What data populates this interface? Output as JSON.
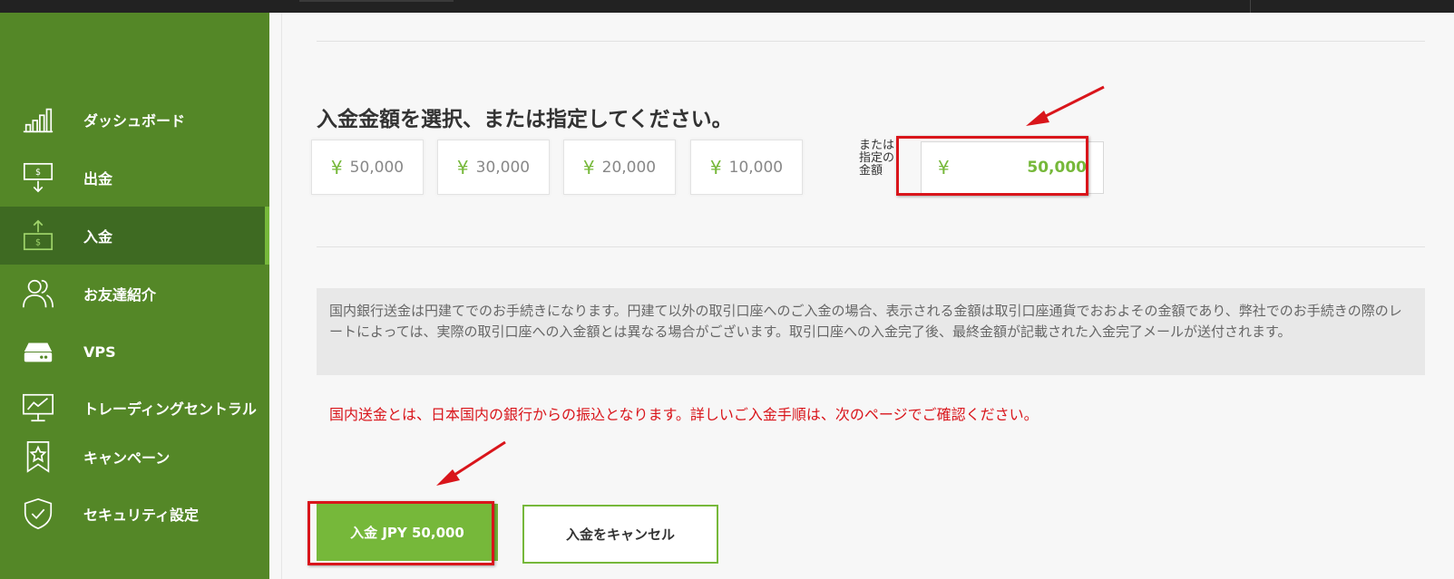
{
  "sidebar": {
    "items": [
      {
        "label": "ダッシュボード",
        "icon": "bar-chart-icon",
        "active": false
      },
      {
        "label": "出金",
        "icon": "withdraw-icon",
        "active": false
      },
      {
        "label": "入金",
        "icon": "deposit-icon",
        "active": true
      },
      {
        "label": "お友達紹介",
        "icon": "users-icon",
        "active": false
      },
      {
        "label": "VPS",
        "icon": "server-icon",
        "active": false
      },
      {
        "label": "トレーディングセントラル",
        "icon": "monitor-chart-icon",
        "active": false
      },
      {
        "label": "キャンペーン",
        "icon": "bookmark-star-icon",
        "active": false
      },
      {
        "label": "セキュリティ設定",
        "icon": "shield-check-icon",
        "active": false
      }
    ]
  },
  "deposit": {
    "heading": "入金金額を選択、または指定してください。",
    "currency_symbol": "¥",
    "presets": [
      "50,000",
      "30,000",
      "20,000",
      "10,000"
    ],
    "custom_label": "または指定の金額",
    "custom_amount": "50,000"
  },
  "notice": {
    "text": "国内銀行送金は円建てでのお手続きになります。円建て以外の取引口座へのご入金の場合、表示される金額は取引口座通貨でおおよその金額であり、弊社でのお手続きの際のレートによっては、実際の取引口座への入金額とは異なる場合がございます。取引口座への入金完了後、最終金額が記載された入金完了メールが送付されます。",
    "red_text": "国内送金とは、日本国内の銀行からの振込となります。詳しいご入金手順は、次のページでご確認ください。"
  },
  "actions": {
    "submit_label": "入金 JPY 50,000",
    "cancel_label": "入金をキャンセル"
  },
  "colors": {
    "sidebar": "#548727",
    "accent": "#76b83a",
    "highlight": "#d9151b"
  }
}
